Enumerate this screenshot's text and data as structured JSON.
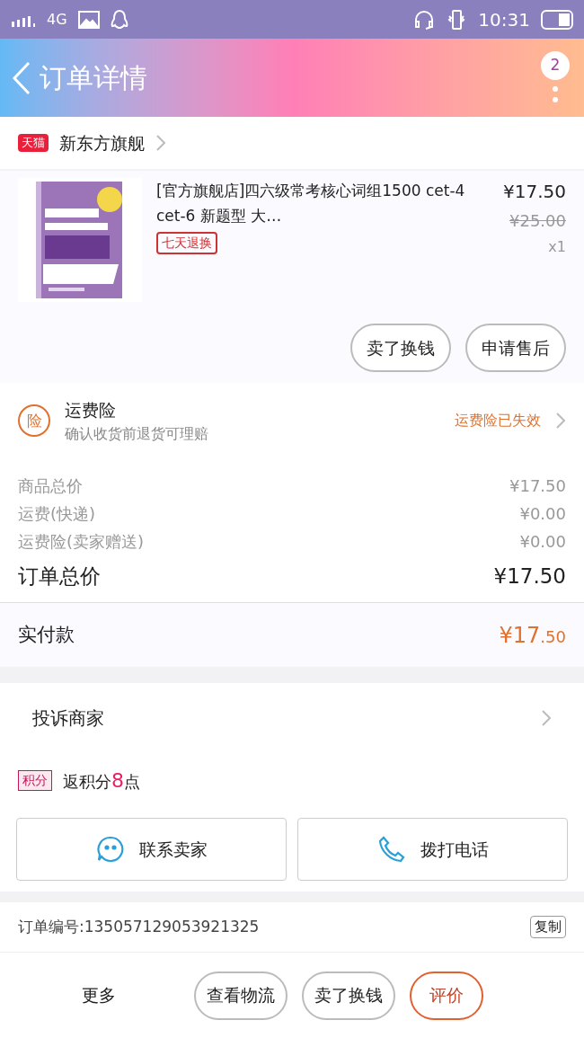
{
  "status_bar": {
    "network": "4G",
    "time": "10:31"
  },
  "header": {
    "title": "订单详情",
    "badge": "2"
  },
  "shop": {
    "tag": "天猫",
    "name": "新东方旗舰"
  },
  "product": {
    "title": "[官方旗舰店]四六级常考核心词组1500 cet-4 cet-6 新题型 大…",
    "tag": "七天退换",
    "price": "¥17.50",
    "original_price": "¥25.00",
    "quantity": "x1",
    "actions": [
      "卖了换钱",
      "申请售后"
    ]
  },
  "insurance": {
    "icon_text": "险",
    "title": "运费险",
    "subtitle": "确认收货前退货可理赔",
    "status": "运费险已失效"
  },
  "costs": [
    {
      "label": "商品总价",
      "value": "¥17.50"
    },
    {
      "label": "运费(快递)",
      "value": "¥0.00"
    },
    {
      "label": "运费险(卖家赠送)",
      "value": "¥0.00"
    }
  ],
  "total": {
    "label": "订单总价",
    "value": "¥17.50"
  },
  "paid": {
    "label": "实付款",
    "currency": "¥17",
    "decimals": ".50"
  },
  "complaint": {
    "label": "投诉商家"
  },
  "points": {
    "tag": "积分",
    "before": "返积分",
    "amount": "8",
    "after": "点"
  },
  "contact_buttons": [
    {
      "kind": "chat",
      "label": "联系卖家"
    },
    {
      "kind": "phone",
      "label": "拨打电话"
    }
  ],
  "order": {
    "number": "订单编号:135057129053921325",
    "copy": "复制"
  },
  "bottom_bar": {
    "more": "更多",
    "buttons": [
      {
        "label": "查看物流",
        "highlighted": false
      },
      {
        "label": "卖了换钱",
        "highlighted": false
      },
      {
        "label": "评价",
        "highlighted": true
      }
    ]
  }
}
